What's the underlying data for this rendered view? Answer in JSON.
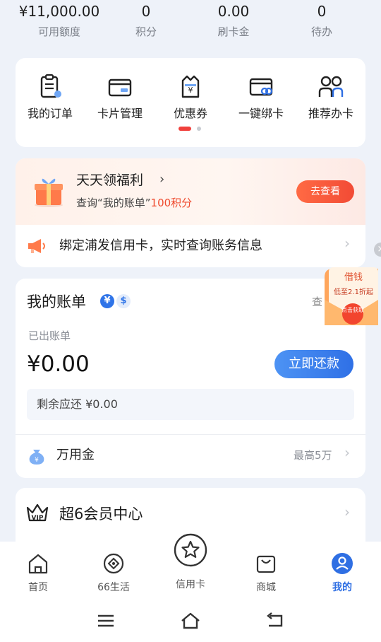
{
  "stats": [
    {
      "value": "¥11,000.00",
      "label": "可用额度"
    },
    {
      "value": "0",
      "label": "积分"
    },
    {
      "value": "0.00",
      "label": "刷卡金"
    },
    {
      "value": "0",
      "label": "待办"
    }
  ],
  "quick_menu": [
    {
      "label": "我的订单",
      "icon": "order-icon"
    },
    {
      "label": "卡片管理",
      "icon": "card-icon"
    },
    {
      "label": "优惠券",
      "icon": "coupon-icon"
    },
    {
      "label": "一键绑卡",
      "icon": "bind-card-icon"
    },
    {
      "label": "推荐办卡",
      "icon": "recommend-icon"
    }
  ],
  "welfare": {
    "title": "天天领福利",
    "subtitle_prefix": "查询“我的账单”",
    "subtitle_highlight": "100积分",
    "button": "去查看"
  },
  "notice": {
    "text": "绑定浦发信用卡，实时查询账务信息"
  },
  "bill": {
    "title": "我的账单",
    "currency_cny": "¥",
    "currency_usd": "$",
    "check_link": "查",
    "issued_label": "已出账单",
    "amount": "¥0.00",
    "repay_button": "立即还款",
    "remaining": "剩余应还 ¥0.00"
  },
  "wanyongjin": {
    "label": "万用金",
    "max": "最高5万"
  },
  "vip": {
    "label": "超6会员中心",
    "icon_text": "VIP"
  },
  "promo": {
    "title": "借钱",
    "subtitle": "低至2.1折起",
    "button": "点击获取"
  },
  "tabs": [
    {
      "label": "首页",
      "icon": "home-icon"
    },
    {
      "label": "66生活",
      "icon": "life-icon"
    },
    {
      "label": "信用卡",
      "icon": "star-icon"
    },
    {
      "label": "商城",
      "icon": "shop-icon"
    },
    {
      "label": "我的",
      "icon": "profile-icon",
      "active": true
    }
  ],
  "colors": {
    "accent": "#2f6fe3",
    "alert": "#f0403c",
    "welfare_orange": "#f24b35"
  }
}
